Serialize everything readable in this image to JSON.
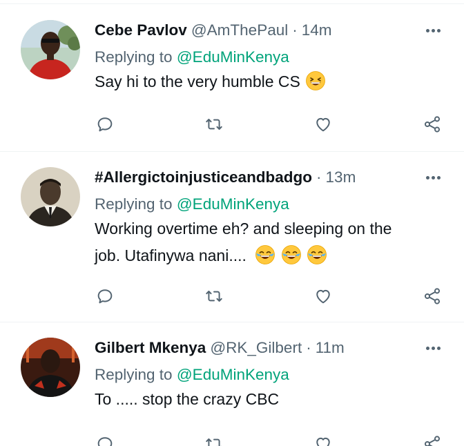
{
  "tweets": [
    {
      "name": "Cebe Pavlov",
      "handle": "@AmThePaul",
      "dot": "·",
      "time": "14m",
      "replying_prefix": "Replying to",
      "replying_to": "@EduMinKenya",
      "text": "Say hi to the very humble CS",
      "emoji": "grinning-squint-face"
    },
    {
      "name": "#Allergictoinjusticeandbadgo",
      "handle": "",
      "dot": "·",
      "time": "13m",
      "replying_prefix": "Replying to",
      "replying_to": "@EduMinKenya",
      "text_line1": "Working overtime eh? and sleeping on the",
      "text_line2": "job. Utafinywa nani....",
      "emoji": "face-with-tears-of-joy"
    },
    {
      "name": "Gilbert Mkenya",
      "handle": "@RK_Gilbert",
      "dot": "·",
      "time": "11m",
      "replying_prefix": "Replying to",
      "replying_to": "@EduMinKenya",
      "text": "To ..... stop the crazy CBC"
    }
  ],
  "icons": {
    "reply": "reply-icon",
    "retweet": "retweet-icon",
    "like": "heart-icon",
    "share": "share-icon",
    "more": "more-icon"
  },
  "colors": {
    "mention": "#00a37a",
    "secondary_text": "#536471",
    "primary_text": "#0f1419",
    "divider": "#eff3f4"
  }
}
